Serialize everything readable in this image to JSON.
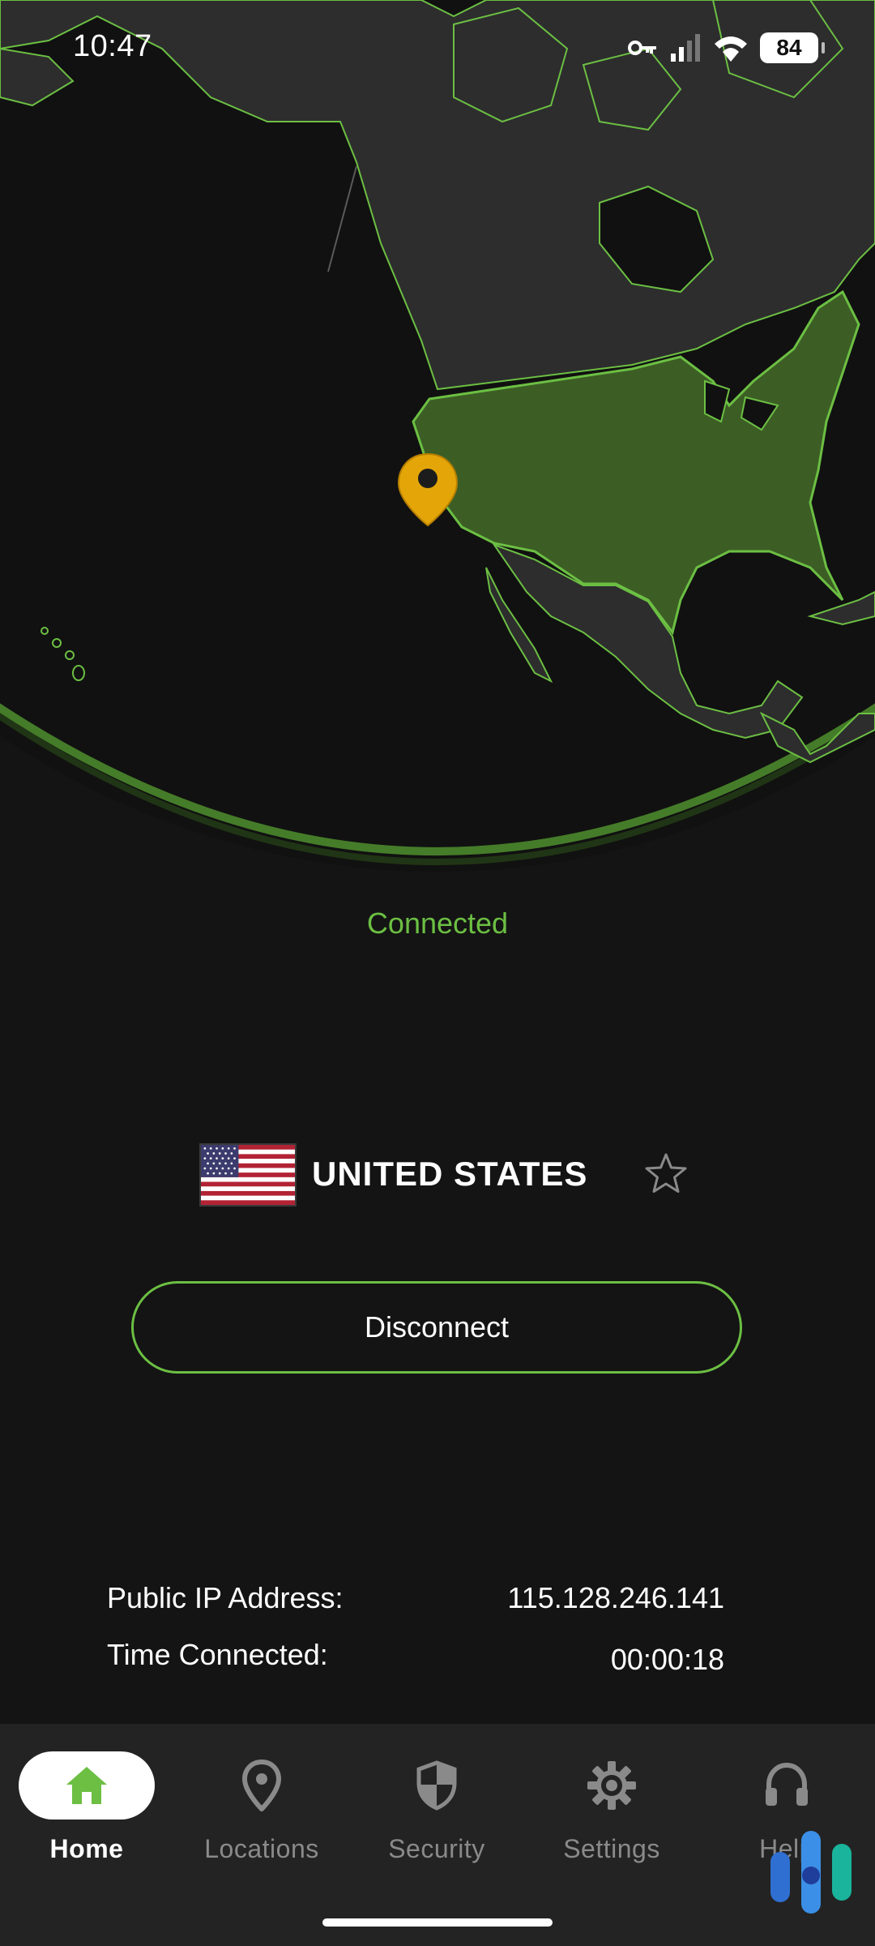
{
  "status_bar": {
    "time": "10:47",
    "battery": "84"
  },
  "connection": {
    "status": "Connected",
    "country": "UNITED STATES",
    "disconnect_label": "Disconnect"
  },
  "info": {
    "ip_label": "Public IP Address:",
    "ip_value": "115.128.246.141",
    "time_label": "Time Connected:",
    "time_value": "00:00:18"
  },
  "nav": {
    "items": [
      {
        "label": "Home",
        "icon": "home-icon",
        "active": true
      },
      {
        "label": "Locations",
        "icon": "location-pin-icon"
      },
      {
        "label": "Security",
        "icon": "shield-icon"
      },
      {
        "label": "Settings",
        "icon": "gear-icon"
      },
      {
        "label": "Help",
        "icon": "headset-icon"
      }
    ]
  },
  "colors": {
    "accent": "#6cbf43",
    "background": "#141414",
    "nav_background": "#232323",
    "land": "#2d2d2d",
    "land_active": "#3c5e25",
    "pin": "#e3a508"
  }
}
